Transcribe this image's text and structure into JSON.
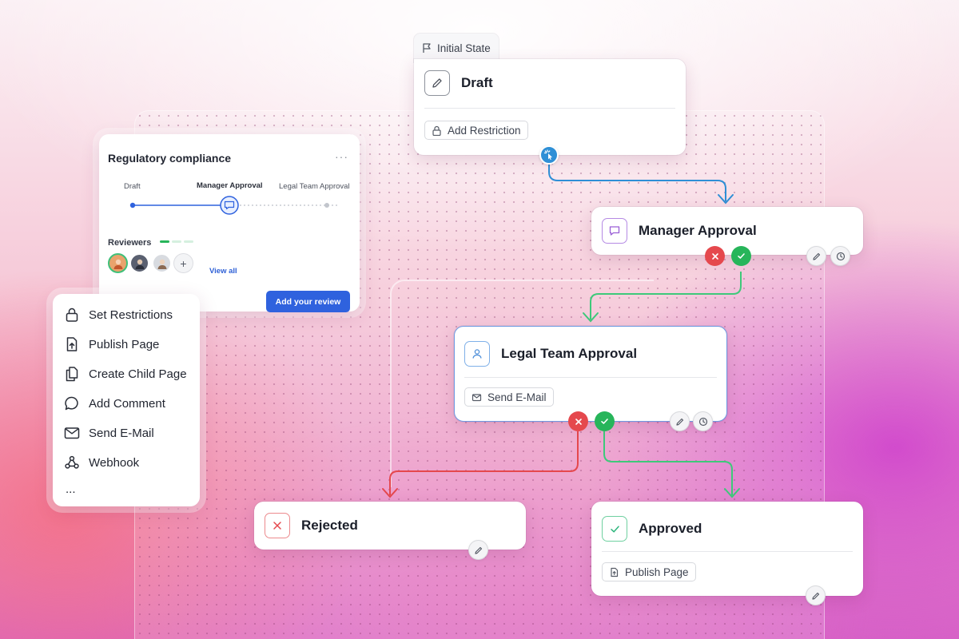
{
  "workflow": {
    "initial_state_tab": "Initial State",
    "draft": {
      "title": "Draft",
      "action_chip": "Add Restriction"
    },
    "manager": {
      "title": "Manager Approval"
    },
    "legal": {
      "title": "Legal Team Approval",
      "action_chip": "Send E-Mail"
    },
    "rejected": {
      "title": "Rejected"
    },
    "approved": {
      "title": "Approved",
      "action_chip": "Publish Page"
    }
  },
  "compliance_panel": {
    "title": "Regulatory compliance",
    "menu": "···",
    "steps": [
      "Draft",
      "Manager Approval",
      "Legal Team Approval"
    ],
    "current_step": 1,
    "reviewers_label": "Reviewers",
    "view_all": "View all",
    "add_review": "Add your review",
    "add_reviewer": "+"
  },
  "action_menu": {
    "items": [
      "Set Restrictions",
      "Publish Page",
      "Create Child Page",
      "Add Comment",
      "Send E-Mail",
      "Webhook"
    ],
    "more": "..."
  },
  "colors": {
    "flow_blue": "#2e8fd6",
    "flow_green": "#3ec97a",
    "flow_red": "#e5484d",
    "accent": "#2f62de",
    "manager_icon": "#9a5fd6",
    "legal_icon": "#4e8fd9",
    "rejected_icon": "#e5484d",
    "approved_icon": "#2eb67d"
  }
}
